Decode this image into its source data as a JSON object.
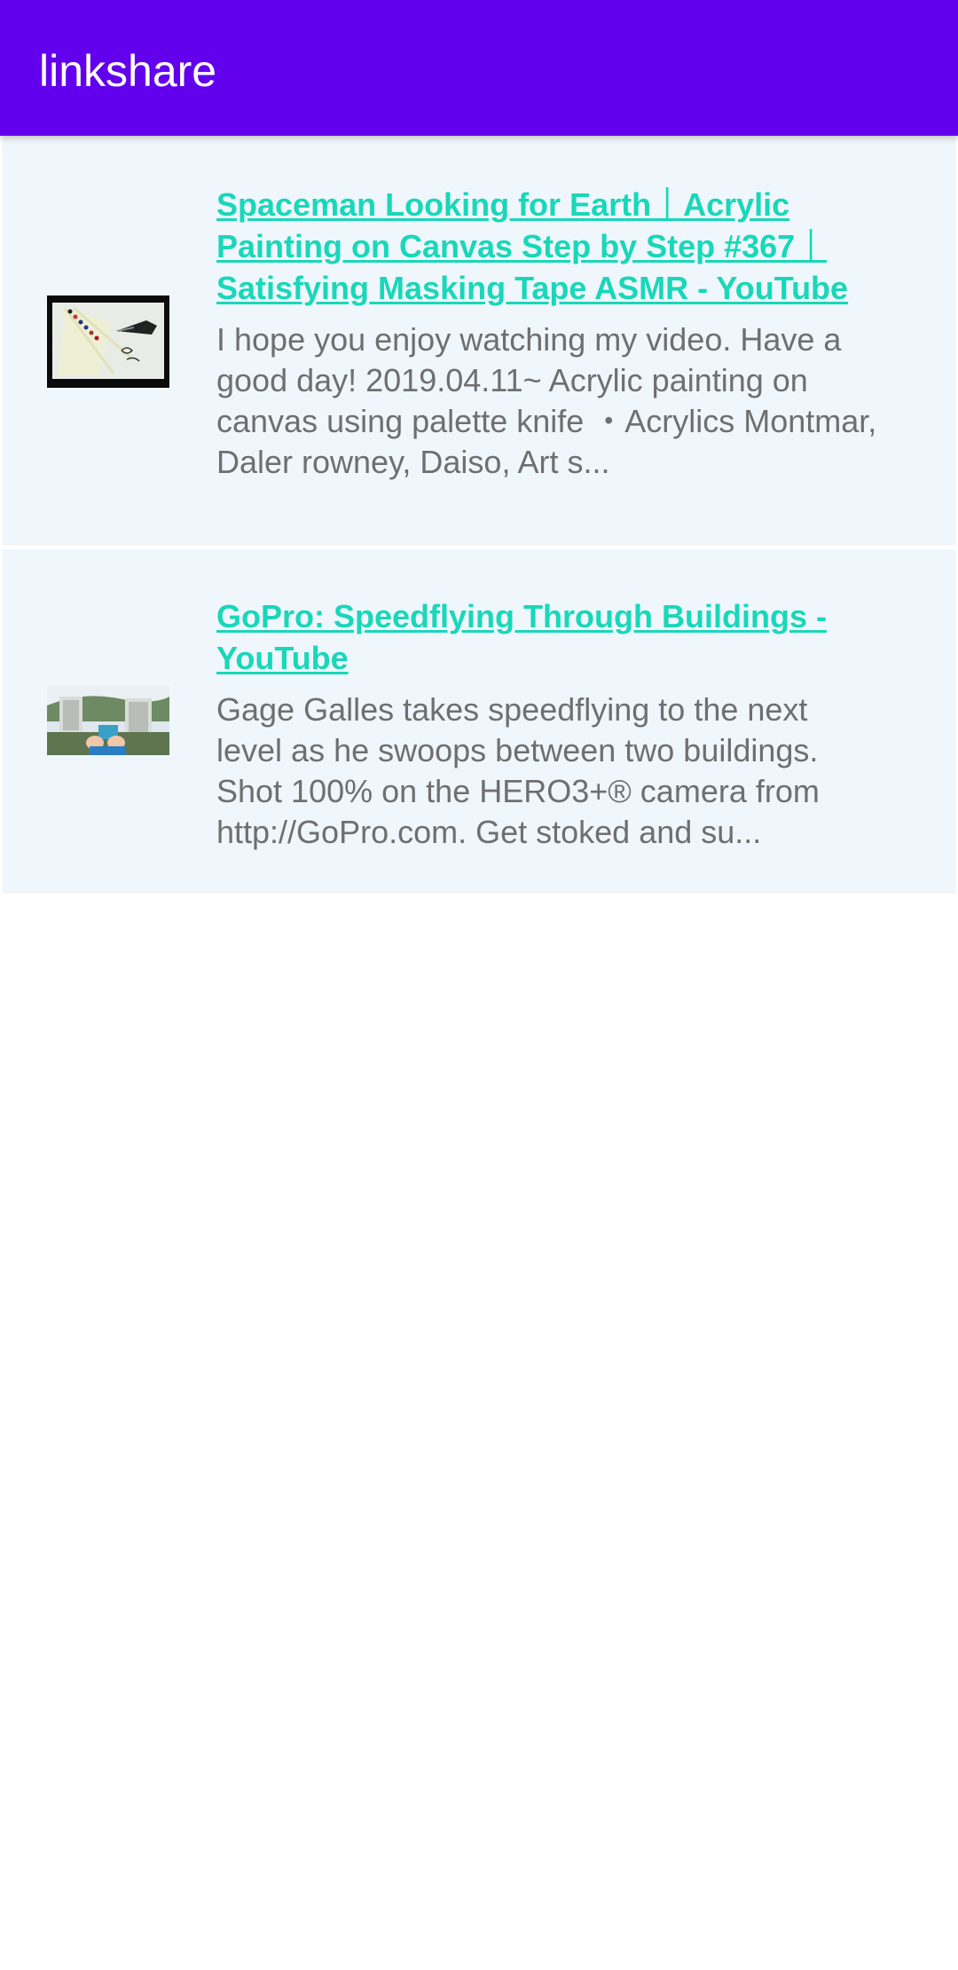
{
  "app": {
    "title": "linkshare"
  },
  "links": [
    {
      "title": "Spaceman Looking for Earth｜Acrylic Painting on Canvas Step by Step #367｜Satisfying Masking Tape ASMR - YouTube",
      "description": "I hope you enjoy watching my video. Have a good day! 2019.04.11~ Acrylic painting on canvas using palette knife ・Acrylics Montmar, Daler rowney, Daiso, Art s...",
      "thumbnail": "painting-thumbnail"
    },
    {
      "title": "GoPro: Speedflying Through Buildings - YouTube",
      "description": "Gage Galles takes speedflying to the next level as he swoops between two buildings. Shot 100% on the HERO3+® camera from http://GoPro.com. Get stoked and su...",
      "thumbnail": "speedflying-thumbnail"
    }
  ],
  "colors": {
    "app_bar": "#6200ee",
    "card_background": "#eff7fd",
    "link": "#19d7b9",
    "description": "#6f6f6f"
  }
}
